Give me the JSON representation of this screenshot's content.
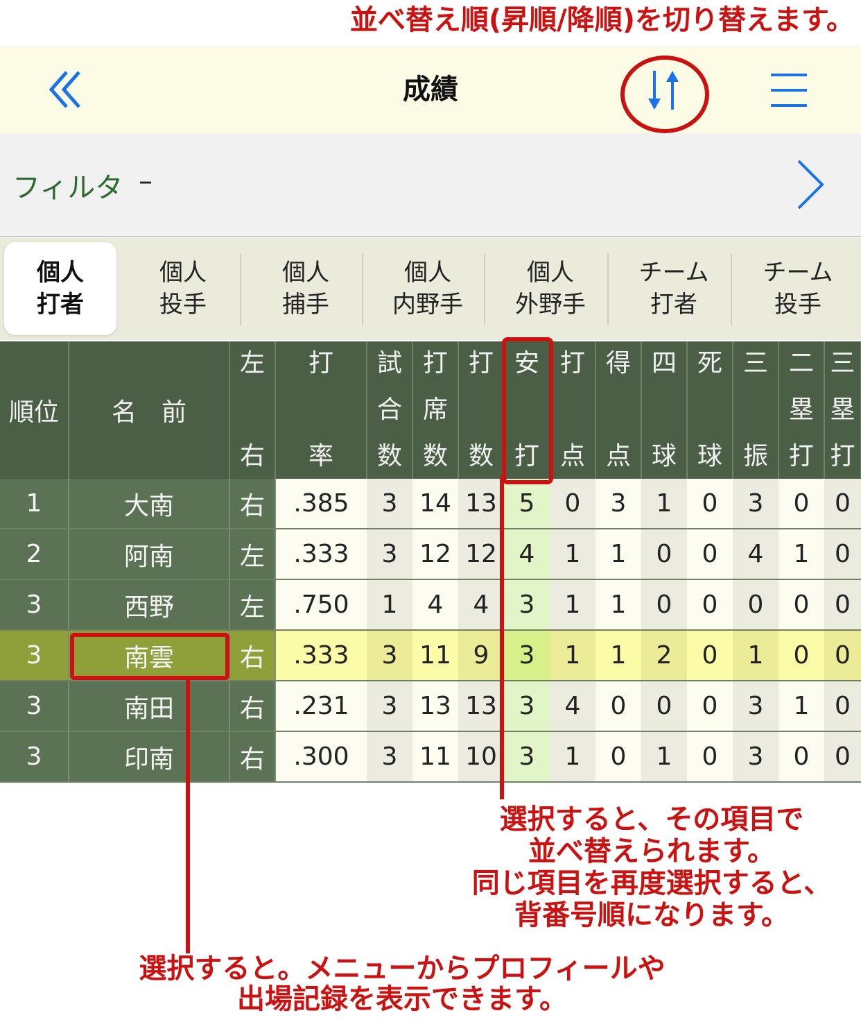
{
  "annotations": {
    "sort_order": "並べ替え順(昇順/降順)を切り替えます。",
    "sort_column": "選択すると、その項目で\n並べ替えられます。\n同じ項目を再度選択すると、\n背番号順になります。",
    "player_select": "選択すると。メニューからプロフィールや\n出場記録を表示できます。"
  },
  "navbar": {
    "title": "成績",
    "back_icon": "double-chevron-left-icon",
    "sort_icon": "sort-up-down-icon",
    "menu_icon": "hamburger-icon"
  },
  "filter": {
    "label": "フィルタ",
    "value": "–"
  },
  "tabs": [
    {
      "line1": "個人",
      "line2": "打者"
    },
    {
      "line1": "個人",
      "line2": "投手"
    },
    {
      "line1": "個人",
      "line2": "捕手"
    },
    {
      "line1": "個人",
      "line2": "内野手"
    },
    {
      "line1": "個人",
      "line2": "外野手"
    },
    {
      "line1": "チーム",
      "line2": "打者"
    },
    {
      "line1": "チーム",
      "line2": "投手"
    }
  ],
  "active_tab": 0,
  "columns": [
    {
      "top": "順位",
      "mid": "",
      "bot": ""
    },
    {
      "top": "名　前",
      "mid": "",
      "bot": ""
    },
    {
      "top": "左",
      "mid": "",
      "bot": "右"
    },
    {
      "top": "打",
      "mid": "",
      "bot": "率"
    },
    {
      "top": "試",
      "mid": "合",
      "bot": "数"
    },
    {
      "top": "打",
      "mid": "席",
      "bot": "数"
    },
    {
      "top": "打",
      "mid": "",
      "bot": "数"
    },
    {
      "top": "安",
      "mid": "",
      "bot": "打"
    },
    {
      "top": "打",
      "mid": "",
      "bot": "点"
    },
    {
      "top": "得",
      "mid": "",
      "bot": "点"
    },
    {
      "top": "四",
      "mid": "",
      "bot": "球"
    },
    {
      "top": "死",
      "mid": "",
      "bot": "球"
    },
    {
      "top": "三",
      "mid": "",
      "bot": "振"
    },
    {
      "top": "二",
      "mid": "塁",
      "bot": "打"
    },
    {
      "top": "三",
      "mid": "塁",
      "bot": "打"
    }
  ],
  "rows": [
    {
      "rank": "1",
      "name": "大南",
      "hand": "右",
      "vals": [
        ".385",
        "3",
        "14",
        "13",
        "5",
        "0",
        "3",
        "1",
        "0",
        "3",
        "0",
        "0"
      ]
    },
    {
      "rank": "2",
      "name": "阿南",
      "hand": "左",
      "vals": [
        ".333",
        "3",
        "12",
        "12",
        "4",
        "1",
        "1",
        "0",
        "0",
        "4",
        "1",
        "0"
      ]
    },
    {
      "rank": "3",
      "name": "西野",
      "hand": "左",
      "vals": [
        ".750",
        "1",
        "4",
        "4",
        "3",
        "1",
        "1",
        "0",
        "0",
        "0",
        "0",
        "0"
      ]
    },
    {
      "rank": "3",
      "name": "南雲",
      "hand": "右",
      "vals": [
        ".333",
        "3",
        "11",
        "9",
        "3",
        "1",
        "1",
        "2",
        "0",
        "1",
        "0",
        "0"
      ]
    },
    {
      "rank": "3",
      "name": "南田",
      "hand": "右",
      "vals": [
        ".231",
        "3",
        "13",
        "13",
        "3",
        "4",
        "0",
        "0",
        "0",
        "3",
        "1",
        "0"
      ]
    },
    {
      "rank": "3",
      "name": "印南",
      "hand": "右",
      "vals": [
        ".300",
        "3",
        "11",
        "10",
        "3",
        "1",
        "0",
        "1",
        "0",
        "3",
        "0",
        "0"
      ]
    }
  ],
  "selected_row": 3,
  "sorted_column": 7,
  "colors": {
    "accent": "#1a73e8",
    "annotation": "#cc1111",
    "header_bg": "#4a5f46"
  }
}
